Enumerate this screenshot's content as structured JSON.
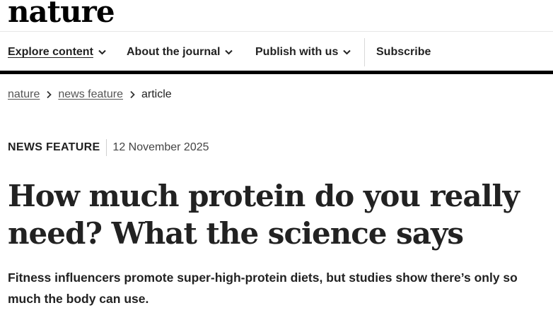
{
  "site": {
    "logo": "nature"
  },
  "nav": {
    "items": [
      {
        "label": "Explore content"
      },
      {
        "label": "About the journal"
      },
      {
        "label": "Publish with us"
      }
    ],
    "subscribe": "Subscribe"
  },
  "breadcrumb": [
    "nature",
    "news feature",
    "article"
  ],
  "article": {
    "type": "NEWS FEATURE",
    "date": "12 November 2025",
    "title": "How much protein do you really need? What the science says",
    "standfirst": "Fitness influencers promote super-high-protein diets, but studies show there’s only so much the body can use."
  },
  "icons": {
    "dropdown": "chevron-down-icon",
    "breadcrumb_separator": "chevron-right-icon"
  },
  "colors": {
    "text": "#222222",
    "rule": "#000000",
    "muted": "#555555"
  }
}
